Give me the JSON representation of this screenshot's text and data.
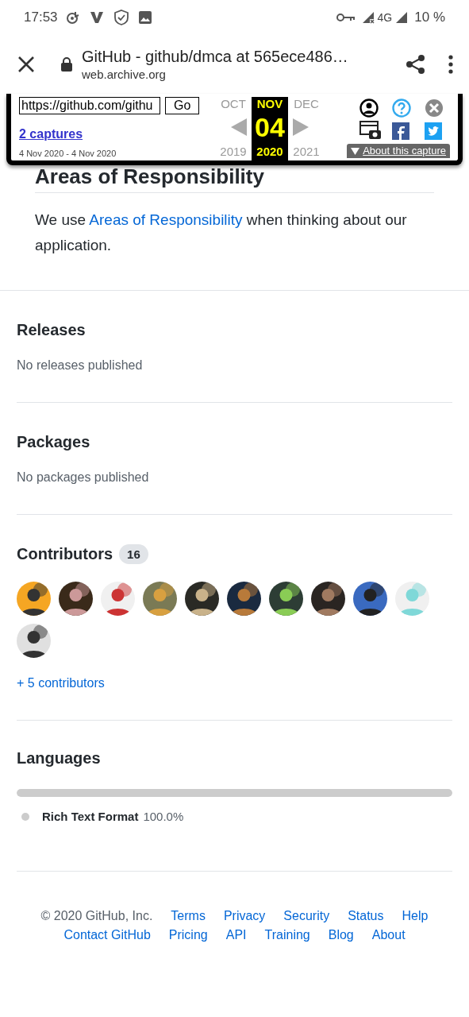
{
  "status_bar": {
    "time": "17:53",
    "network": "4G",
    "battery": "10 %"
  },
  "browser_bar": {
    "title": "GitHub - github/dmca at 565ece486…",
    "domain": "web.archive.org"
  },
  "wayback": {
    "url": "https://github.com/githu",
    "go": "Go",
    "captures": "2 captures",
    "range": "4 Nov 2020 - 4 Nov 2020",
    "months": [
      {
        "label": "OCT",
        "selected": false
      },
      {
        "label": "NOV",
        "selected": true
      },
      {
        "label": "DEC",
        "selected": false
      }
    ],
    "day": "04",
    "years": [
      {
        "label": "2019",
        "selected": false
      },
      {
        "label": "2020",
        "selected": true
      },
      {
        "label": "2021",
        "selected": false
      }
    ],
    "about": "About this capture"
  },
  "readme": {
    "heading": "Areas of Responsibility",
    "text_before": "We use ",
    "link": "Areas of Responsibility",
    "text_after": " when thinking about our application."
  },
  "sections": [
    {
      "kind": "text",
      "title": "Releases",
      "body": "No releases published"
    },
    {
      "kind": "text",
      "title": "Packages",
      "body": "No packages published"
    },
    {
      "kind": "contributors",
      "title": "Contributors",
      "count": "16",
      "more": "+ 5 contributors"
    },
    {
      "kind": "languages",
      "title": "Languages",
      "level": 1,
      "languages": [
        {
          "name": "Rich Text Format",
          "percent": "100.0%",
          "color": "#cccccc"
        }
      ]
    }
  ],
  "footer": {
    "copyright": "© 2020 GitHub, Inc.",
    "links": [
      "Terms",
      "Privacy",
      "Security",
      "Status",
      "Help",
      "Contact GitHub",
      "Pricing",
      "API",
      "Training",
      "Blog",
      "About"
    ]
  }
}
